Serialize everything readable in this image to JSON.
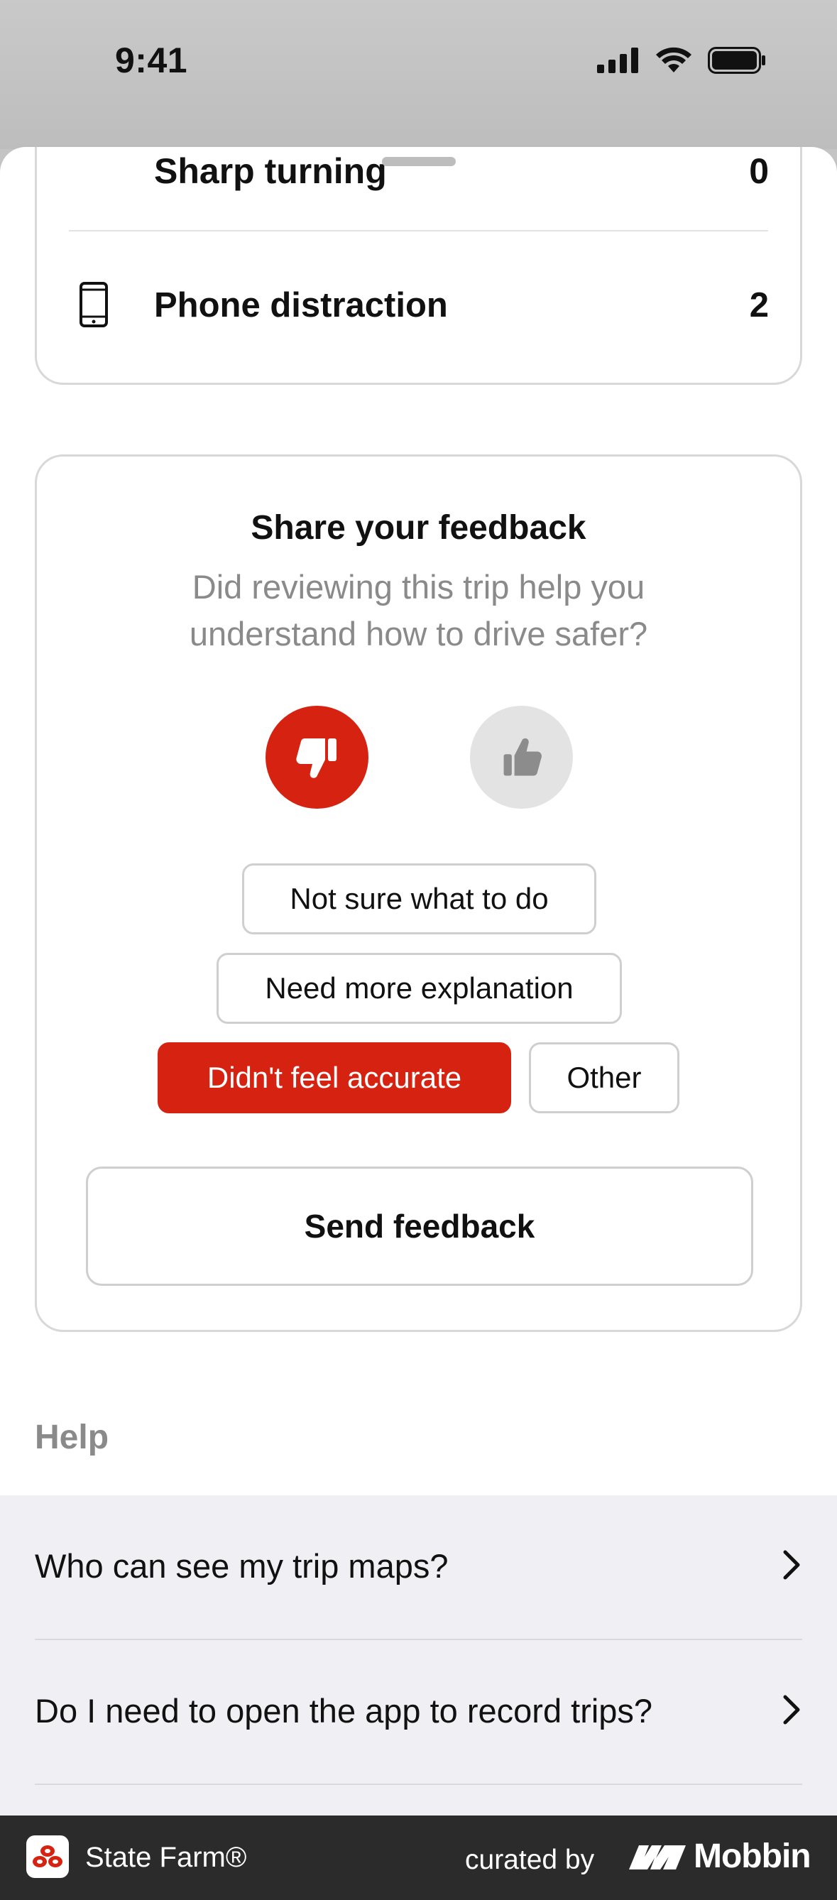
{
  "status_bar": {
    "time": "9:41",
    "icons": [
      "cellular-signal-icon",
      "wifi-icon",
      "battery-icon"
    ]
  },
  "events_card": {
    "peek_label": "Sharp turning",
    "peek_value": "0",
    "rows": [
      {
        "icon": "phone-icon",
        "label": "Phone distraction",
        "value": "2"
      }
    ]
  },
  "feedback": {
    "title": "Share your feedback",
    "subtitle": "Did reviewing this trip help you understand how to drive safer?",
    "thumbs_down_icon": "thumbs-down-icon",
    "thumbs_up_icon": "thumbs-up-icon",
    "selected_rating": "thumbs-down",
    "options": [
      {
        "label": "Not sure what to do",
        "selected": false
      },
      {
        "label": "Need more explanation",
        "selected": false
      },
      {
        "label": "Didn't feel accurate",
        "selected": true
      },
      {
        "label": "Other",
        "selected": false
      }
    ],
    "send_label": "Send feedback"
  },
  "help": {
    "heading": "Help",
    "items": [
      {
        "label": "Who can see my trip maps?"
      },
      {
        "label": "Do I need to open the app to record trips?"
      }
    ]
  },
  "footer": {
    "brand": "State Farm®",
    "curated_by": "curated by",
    "mobbin": "Mobbin"
  },
  "colors": {
    "accent": "#d62311",
    "muted_text": "#8a8a8a",
    "border": "#d8d8d8",
    "help_bg": "#f0eff4",
    "footer_bg": "#2b2b2b"
  }
}
